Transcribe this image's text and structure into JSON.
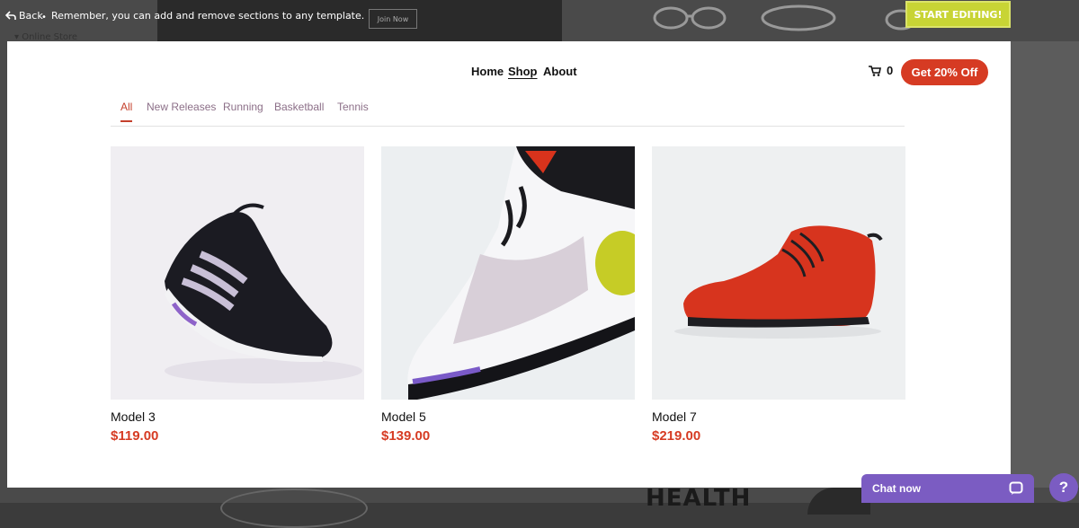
{
  "editor_bar": {
    "back_label": "Back",
    "notice": "Remember, you can add and remove sections to any template.",
    "online_store_label": "Online Store",
    "start_editing_label": "START EDITING!",
    "background_join_label": "Join Now",
    "background_heading": "HEALTH"
  },
  "nav": {
    "links": [
      {
        "label": "Home",
        "active": false
      },
      {
        "label": "Shop",
        "active": true
      },
      {
        "label": "About",
        "active": false
      }
    ],
    "cart_count": "0",
    "promo_label": "Get 20% Off"
  },
  "categories": [
    {
      "label": "All",
      "active": true
    },
    {
      "label": "New Releases",
      "active": false
    },
    {
      "label": "Running",
      "active": false
    },
    {
      "label": "Basketball",
      "active": false
    },
    {
      "label": "Tennis",
      "active": false
    }
  ],
  "products": [
    {
      "name": "Model 3",
      "price": "$119.00",
      "image": "black-purple-sneaker"
    },
    {
      "name": "Model 5",
      "price": "$139.00",
      "image": "white-lime-runner"
    },
    {
      "name": "Model 7",
      "price": "$219.00",
      "image": "red-high-top"
    }
  ],
  "chat": {
    "label": "Chat now",
    "help_label": "?"
  },
  "colors": {
    "accent": "#d63b23",
    "tab_text": "#8c6f88",
    "start_button": "#c8d435",
    "chat_purple": "#7b5cc2"
  }
}
